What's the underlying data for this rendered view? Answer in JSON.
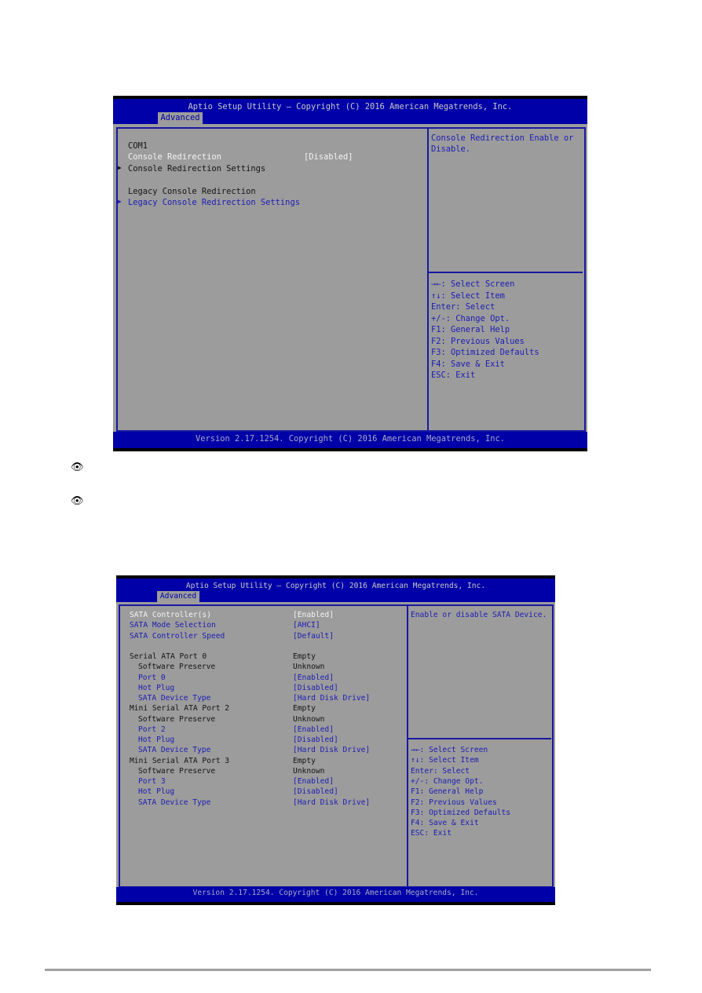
{
  "screens": [
    {
      "title": "Aptio Setup Utility – Copyright (C) 2016 American Megatrends, Inc.",
      "tab": "Advanced",
      "items": [
        {
          "label": "COM1",
          "value": "",
          "style": "black",
          "indent": 0,
          "arrow": false
        },
        {
          "label": "Console Redirection",
          "value": "[Disabled]",
          "style": "white",
          "indent": 0,
          "arrow": false
        },
        {
          "label": "Console Redirection Settings",
          "value": "",
          "style": "black",
          "indent": 0,
          "arrow": true
        },
        {
          "label": "",
          "value": "",
          "style": "black",
          "indent": 0,
          "arrow": false
        },
        {
          "label": "Legacy Console Redirection",
          "value": "",
          "style": "black",
          "indent": 0,
          "arrow": false
        },
        {
          "label": "Legacy Console Redirection Settings",
          "value": "",
          "style": "blue",
          "indent": 0,
          "arrow": true
        }
      ],
      "help_text": [
        "Console Redirection Enable or",
        "Disable."
      ],
      "keys": [
        "→←: Select Screen",
        "↑↓: Select Item",
        "Enter: Select",
        "+/-: Change Opt.",
        "F1: General Help",
        "F2: Previous Values",
        "F3: Optimized Defaults",
        "F4: Save & Exit",
        "ESC: Exit"
      ],
      "footer": "Version 2.17.1254. Copyright (C) 2016 American Megatrends, Inc."
    },
    {
      "title": "Aptio Setup Utility – Copyright (C) 2016 American Megatrends, Inc.",
      "tab": "Advanced",
      "items": [
        {
          "label": "SATA Controller(s)",
          "value": "[Enabled]",
          "style": "white",
          "indent": 0
        },
        {
          "label": "SATA Mode Selection",
          "value": "[AHCI]",
          "style": "blue",
          "indent": 0
        },
        {
          "label": "SATA Controller Speed",
          "value": "[Default]",
          "style": "blue",
          "indent": 0
        },
        {
          "label": "",
          "value": "",
          "style": "black",
          "indent": 0
        },
        {
          "label": "Serial ATA Port 0",
          "value": "Empty",
          "style": "black",
          "indent": 0
        },
        {
          "label": "Software Preserve",
          "value": "Unknown",
          "style": "black",
          "indent": 1
        },
        {
          "label": "Port 0",
          "value": "[Enabled]",
          "style": "blue",
          "indent": 1
        },
        {
          "label": "Hot Plug",
          "value": "[Disabled]",
          "style": "blue",
          "indent": 1
        },
        {
          "label": "SATA Device Type",
          "value": "[Hard Disk Drive]",
          "style": "blue",
          "indent": 1
        },
        {
          "label": "Mini Serial ATA Port 2",
          "value": "Empty",
          "style": "black",
          "indent": 0
        },
        {
          "label": "Software Preserve",
          "value": "Unknown",
          "style": "black",
          "indent": 1
        },
        {
          "label": "Port 2",
          "value": "[Enabled]",
          "style": "blue",
          "indent": 1
        },
        {
          "label": "Hot Plug",
          "value": "[Disabled]",
          "style": "blue",
          "indent": 1
        },
        {
          "label": "SATA Device Type",
          "value": "[Hard Disk Drive]",
          "style": "blue",
          "indent": 1
        },
        {
          "label": "Mini Serial ATA Port 3",
          "value": "Empty",
          "style": "black",
          "indent": 0
        },
        {
          "label": "Software Preserve",
          "value": "Unknown",
          "style": "black",
          "indent": 1
        },
        {
          "label": "Port 3",
          "value": "[Enabled]",
          "style": "blue",
          "indent": 1
        },
        {
          "label": "Hot Plug",
          "value": "[Disabled]",
          "style": "blue",
          "indent": 1
        },
        {
          "label": "SATA Device Type",
          "value": "[Hard Disk Drive]",
          "style": "blue",
          "indent": 1
        }
      ],
      "help_text": [
        "Enable or disable SATA Device."
      ],
      "keys": [
        "→←: Select Screen",
        "↑↓: Select Item",
        "Enter: Select",
        "+/-: Change Opt.",
        "F1: General Help",
        "F2: Previous Values",
        "F3: Optimized Defaults",
        "F4: Save & Exit",
        "ESC: Exit"
      ],
      "footer": "Version 2.17.1254. Copyright (C) 2016 American Megatrends, Inc."
    }
  ],
  "notes": [
    {
      "icon": "eye-icon"
    },
    {
      "icon": "eye-icon"
    }
  ],
  "colors": {
    "bios_blue": "#0000a8",
    "bios_gray": "#9c9c9c",
    "item_blue": "#1c1cb4",
    "item_white": "#f4f4f4"
  }
}
